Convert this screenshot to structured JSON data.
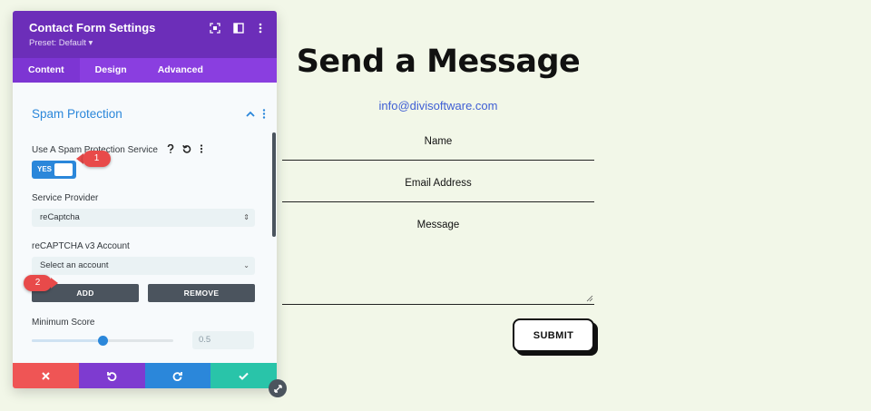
{
  "form": {
    "heading": "Send a Message",
    "email": "info@divisoftware.com",
    "name_label": "Name",
    "email_label": "Email Address",
    "message_label": "Message",
    "submit_label": "SUBMIT"
  },
  "panel": {
    "title": "Contact Form Settings",
    "preset": "Preset: Default ▾",
    "tabs": [
      {
        "label": "Content"
      },
      {
        "label": "Design"
      },
      {
        "label": "Advanced"
      }
    ],
    "section_title": "Spam Protection",
    "spam_label": "Use A Spam Protection Service",
    "toggle_text": "YES",
    "service_label": "Service Provider",
    "service_value": "reCaptcha",
    "account_label": "reCAPTCHA v3 Account",
    "account_value": "Select an account",
    "add_label": "ADD",
    "remove_label": "REMOVE",
    "score_label": "Minimum Score",
    "score_value": "0.5",
    "slider_fraction": 0.5
  },
  "annotations": {
    "badge1": "1",
    "badge2": "2"
  },
  "colors": {
    "header": "#6c2eb9",
    "tabs": "#8a3ee0",
    "accent": "#2b87da",
    "cancel": "#ef5555",
    "undo": "#7e3bd0",
    "redo": "#2b87da",
    "save": "#29c4a9",
    "badge": "#e84a4a",
    "link": "#3f5fd4"
  },
  "icons": {
    "header": [
      "focus-icon",
      "split-view-icon",
      "more-icon"
    ],
    "footer": [
      "close-icon",
      "undo-icon",
      "redo-icon",
      "check-icon"
    ]
  }
}
